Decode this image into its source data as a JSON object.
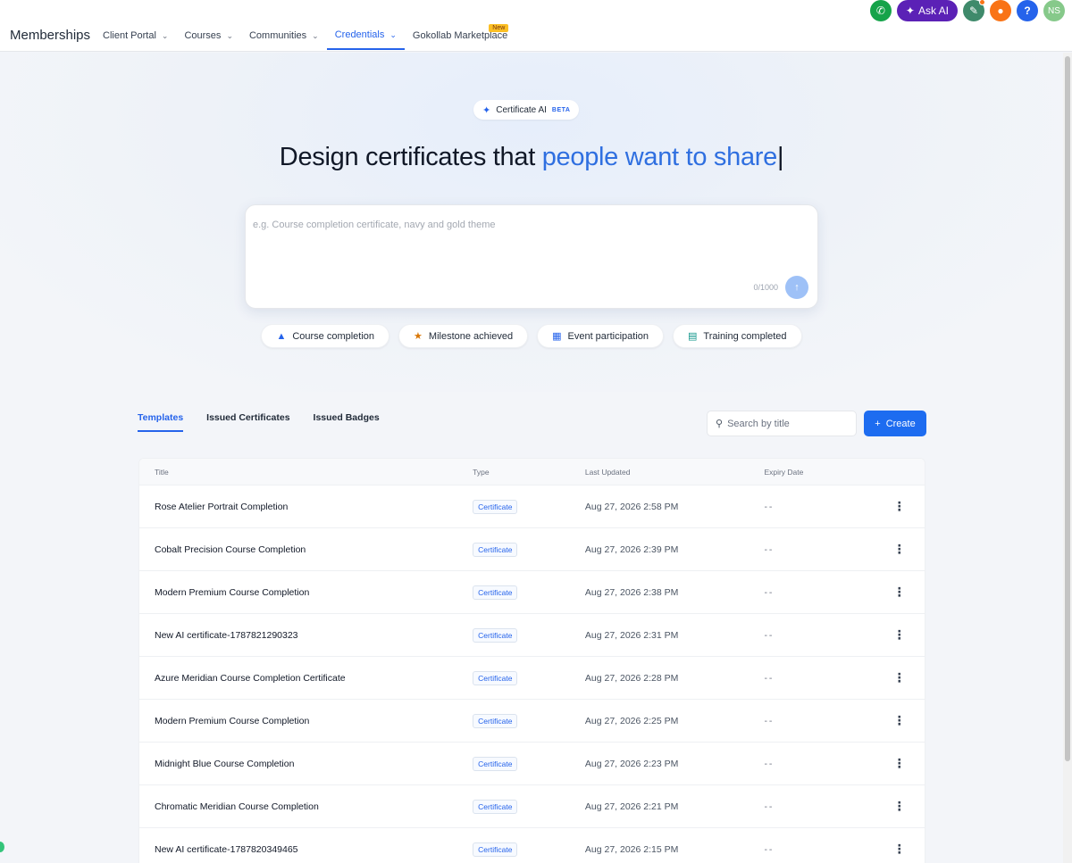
{
  "app": {
    "title": "Memberships"
  },
  "utility": {
    "ask_ai_label": "Ask AI",
    "help_label": "?",
    "avatar_initials": "NS"
  },
  "nav": {
    "items": [
      {
        "label": "Client Portal",
        "has_dropdown": true,
        "active": false
      },
      {
        "label": "Courses",
        "has_dropdown": true,
        "active": false
      },
      {
        "label": "Communities",
        "has_dropdown": true,
        "active": false
      },
      {
        "label": "Credentials",
        "has_dropdown": true,
        "active": true
      },
      {
        "label": "Gokollab Marketplace",
        "has_dropdown": false,
        "active": false,
        "badge": "New"
      }
    ]
  },
  "hero": {
    "pill_label": "Certificate AI",
    "pill_badge": "BETA",
    "title_plain": "Design certificates that ",
    "title_accent": "people want to share",
    "prompt_placeholder": "e.g. Course completion certificate, navy and gold theme",
    "char_count": "0/1000",
    "chips": [
      {
        "label": "Course completion",
        "icon": "graduation-cap-icon"
      },
      {
        "label": "Milestone achieved",
        "icon": "trophy-icon"
      },
      {
        "label": "Event participation",
        "icon": "calendar-icon"
      },
      {
        "label": "Training completed",
        "icon": "open-book-icon"
      }
    ]
  },
  "tabs": [
    {
      "label": "Templates",
      "active": true
    },
    {
      "label": "Issued Certificates",
      "active": false
    },
    {
      "label": "Issued Badges",
      "active": false
    }
  ],
  "search": {
    "placeholder": "Search by title"
  },
  "create_label": "Create",
  "table": {
    "columns": [
      "Title",
      "Type",
      "Last Updated",
      "Expiry Date"
    ],
    "rows": [
      {
        "title": "Rose Atelier Portrait Completion",
        "type": "Certificate",
        "updated": "Aug 27, 2026 2:58 PM",
        "expiry": "--"
      },
      {
        "title": "Cobalt Precision Course Completion",
        "type": "Certificate",
        "updated": "Aug 27, 2026 2:39 PM",
        "expiry": "--"
      },
      {
        "title": "Modern Premium Course Completion",
        "type": "Certificate",
        "updated": "Aug 27, 2026 2:38 PM",
        "expiry": "--"
      },
      {
        "title": "New AI certificate-1787821290323",
        "type": "Certificate",
        "updated": "Aug 27, 2026 2:31 PM",
        "expiry": "--"
      },
      {
        "title": "Azure Meridian Course Completion Certificate",
        "type": "Certificate",
        "updated": "Aug 27, 2026 2:28 PM",
        "expiry": "--"
      },
      {
        "title": "Modern Premium Course Completion",
        "type": "Certificate",
        "updated": "Aug 27, 2026 2:25 PM",
        "expiry": "--"
      },
      {
        "title": "Midnight Blue Course Completion",
        "type": "Certificate",
        "updated": "Aug 27, 2026 2:23 PM",
        "expiry": "--"
      },
      {
        "title": "Chromatic Meridian Course Completion",
        "type": "Certificate",
        "updated": "Aug 27, 2026 2:21 PM",
        "expiry": "--"
      },
      {
        "title": "New AI certificate-1787820349465",
        "type": "Certificate",
        "updated": "Aug 27, 2026 2:15 PM",
        "expiry": "--"
      }
    ]
  },
  "colors": {
    "accent": "#2563eb",
    "create_button": "#1d6cf0",
    "ask_ai": "#5b21b6",
    "phone": "#16a34a",
    "bell": "#f97316"
  }
}
